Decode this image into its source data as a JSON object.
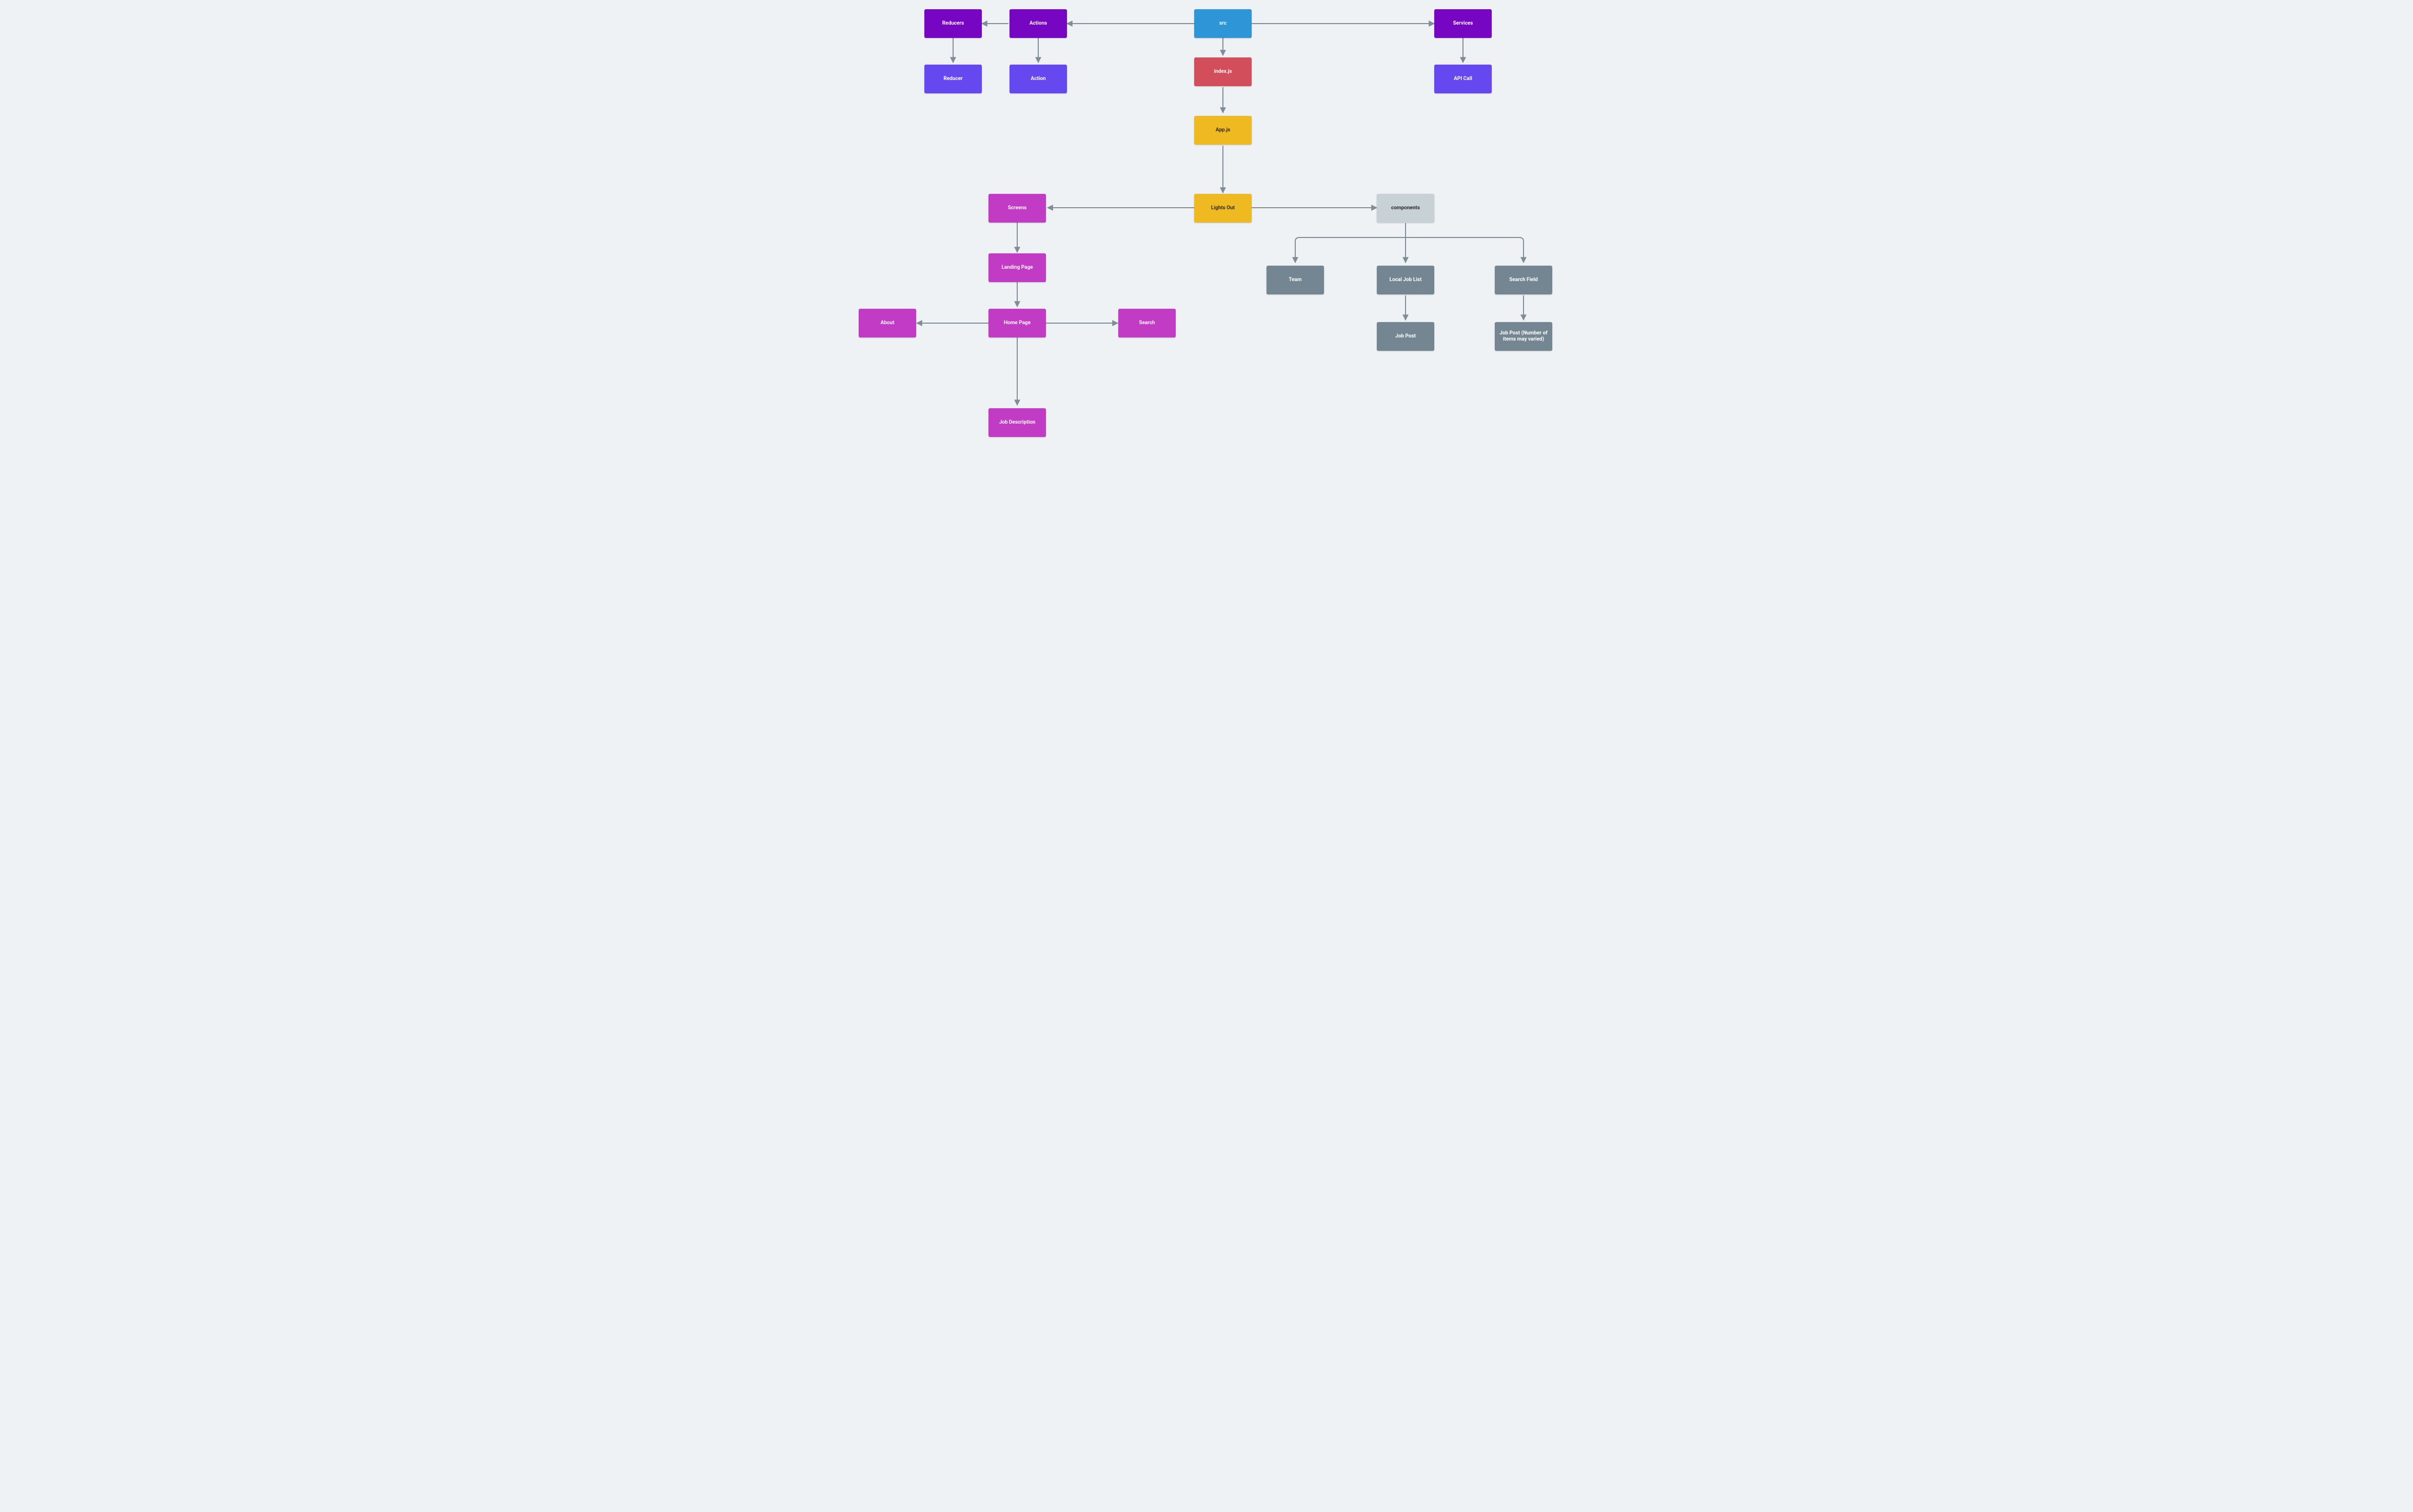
{
  "nodes": {
    "src": {
      "label": "src",
      "color": "c-blue"
    },
    "reducers": {
      "label": "Reducers",
      "color": "c-purple"
    },
    "actions": {
      "label": "Actions",
      "color": "c-purple"
    },
    "services": {
      "label": "Services",
      "color": "c-purple"
    },
    "reducer": {
      "label": "Reducer",
      "color": "c-indigo"
    },
    "action": {
      "label": "Action",
      "color": "c-indigo"
    },
    "apicall": {
      "label": "API Call",
      "color": "c-indigo"
    },
    "indexjs": {
      "label": "index.js",
      "color": "c-red"
    },
    "appjs": {
      "label": "App.js",
      "color": "c-yellow"
    },
    "lightsout": {
      "label": "Lights Out",
      "color": "c-yellow"
    },
    "screens": {
      "label": "Screens",
      "color": "c-magenta"
    },
    "components": {
      "label": "components",
      "color": "c-lgray"
    },
    "landingpage": {
      "label": "Landing Page",
      "color": "c-magenta"
    },
    "homepage": {
      "label": "Home Page",
      "color": "c-magenta"
    },
    "about": {
      "label": "About",
      "color": "c-magenta"
    },
    "search": {
      "label": "Search",
      "color": "c-magenta"
    },
    "jobdesc": {
      "label": "Job Description",
      "color": "c-magenta"
    },
    "team": {
      "label": "Team",
      "color": "c-slate"
    },
    "localjoblist": {
      "label": "Local Job List",
      "color": "c-slate"
    },
    "searchfield": {
      "label": "Search Field",
      "color": "c-slate"
    },
    "jobpost": {
      "label": "Job Post",
      "color": "c-slate"
    },
    "jobpostvar": {
      "label": "Job Post (Number of items may varied)",
      "color": "c-slate"
    }
  }
}
